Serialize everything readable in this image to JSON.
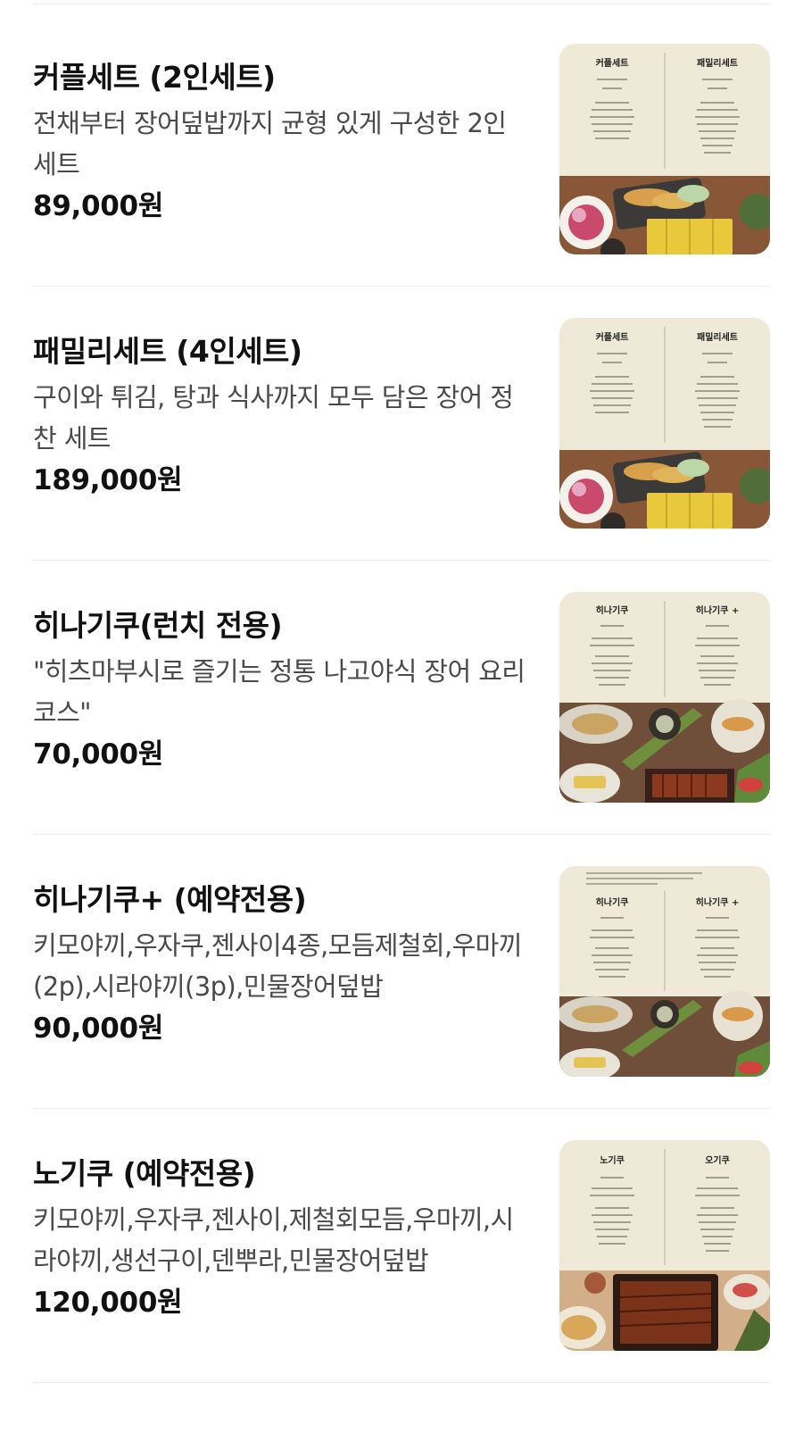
{
  "menu": {
    "items": [
      {
        "name": "커플세트 (2인세트)",
        "description": "전채부터 장어덮밥까지 균형 있게 구성한 2인 세트",
        "price": "89,000원",
        "thumbnail": {
          "menu_left_title": "커플세트",
          "menu_right_title": "패밀리세트",
          "photo_style": "tempura"
        }
      },
      {
        "name": "패밀리세트 (4인세트)",
        "description": "구이와 튀김, 탕과 식사까지 모두 담은 장어 정찬 세트",
        "price": "189,000원",
        "thumbnail": {
          "menu_left_title": "커플세트",
          "menu_right_title": "패밀리세트",
          "photo_style": "tempura"
        }
      },
      {
        "name": "히나기쿠(런치 전용)",
        "description": "\"히츠마부시로 즐기는 정통 나고야식 장어 요리 코스\"",
        "price": "70,000원",
        "thumbnail": {
          "menu_left_title": "히나기쿠",
          "menu_right_title": "히나기쿠 +",
          "photo_style": "course"
        }
      },
      {
        "name": "히나기쿠+ (예약전용)",
        "description": "키모야끼,우자쿠,젠사이4종,모듬제철회,우마끼(2p),시라야끼(3p),민물장어덮밥",
        "price": "90,000원",
        "thumbnail": {
          "menu_left_title": "히나기쿠",
          "menu_right_title": "히나기쿠 +",
          "photo_style": "course"
        }
      },
      {
        "name": "노기쿠 (예약전용)",
        "description": "키모야끼,우자쿠,젠사이,제철회모듬,우마끼,시라야끼,생선구이,덴뿌라,민물장어덮밥",
        "price": "120,000원",
        "thumbnail": {
          "menu_left_title": "노기쿠",
          "menu_right_title": "오기쿠",
          "photo_style": "unagi-don"
        }
      }
    ]
  },
  "colors": {
    "text_primary": "#111111",
    "text_secondary": "#4a4a4a",
    "divider": "#ececec",
    "menu_paper": "#efe9d8",
    "photo_wood": "#8a5a3a"
  }
}
